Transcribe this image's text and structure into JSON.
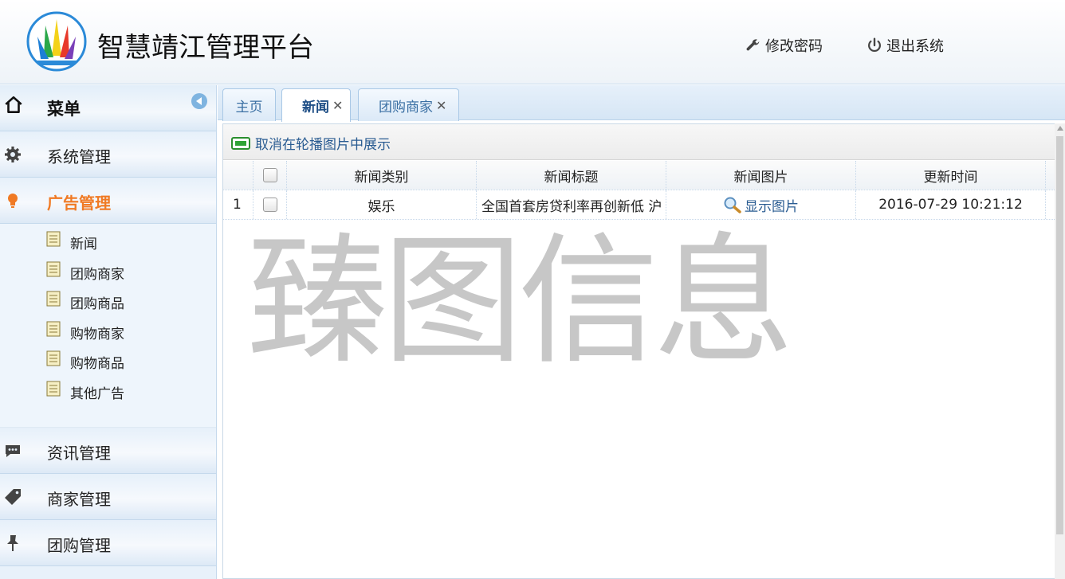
{
  "app": {
    "title": "智慧靖江管理平台"
  },
  "header": {
    "change_password": "修改密码",
    "logout": "退出系统"
  },
  "sidebar": {
    "title": "菜单",
    "groups": [
      {
        "label": "系统管理",
        "icon": "gear-icon"
      },
      {
        "label": "广告管理",
        "icon": "bulb-icon",
        "active": true
      },
      {
        "label": "资讯管理",
        "icon": "chat-bubble-icon"
      },
      {
        "label": "商家管理",
        "icon": "tag-icon"
      },
      {
        "label": "团购管理",
        "icon": "pin-icon"
      }
    ],
    "sub_items": [
      "新闻",
      "团购商家",
      "团购商品",
      "购物商家",
      "购物商品",
      "其他广告"
    ]
  },
  "tabs": [
    {
      "label": "主页"
    },
    {
      "label": "新闻",
      "active": true
    },
    {
      "label": "团购商家"
    }
  ],
  "toolbar": {
    "cancel_carousel": "取消在轮播图片中展示"
  },
  "table": {
    "columns": [
      "新闻类别",
      "新闻标题",
      "新闻图片",
      "更新时间"
    ],
    "rows": [
      {
        "num": "1",
        "type": "娱乐",
        "title": "全国首套房贷利率再创新低 沪",
        "image_link": "显示图片",
        "time": "2016-07-29 10:21:12"
      }
    ]
  },
  "watermark": "臻图信息",
  "colors": {
    "accent": "#f07a24",
    "link": "#2a5c92",
    "border": "#c5d9ec"
  }
}
